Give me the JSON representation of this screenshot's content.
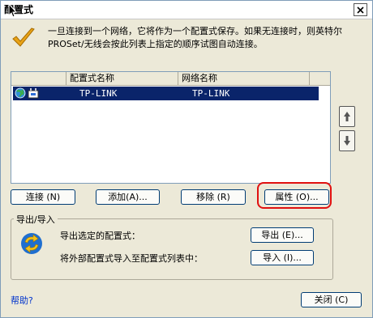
{
  "window": {
    "title": "配置式"
  },
  "intro_text": "一旦连接到一个网络，它将作为一个配置式保存。如果无连接时，则英特尔 PROSet/无线会按此列表上指定的顺序试图自动连接。",
  "list": {
    "columns": [
      "配置式名称",
      "网络名称"
    ],
    "rows": [
      {
        "profile_name": "TP-LINK",
        "network_name": "TP-LINK",
        "selected": true
      }
    ]
  },
  "buttons": {
    "connect": "连接 (N)",
    "add": "添加(A)...",
    "remove": "移除 (R)",
    "properties": "属性 (O)...",
    "export": "导出 (E)...",
    "import": "导入 (I)...",
    "close": "关闭 (C)"
  },
  "import_export": {
    "title": "导出/导入",
    "export_label": "导出选定的配置式：",
    "import_label": "将外部配置式导入至配置式列表中："
  },
  "help_link": "帮助?",
  "colors": {
    "selection": "#0a246a",
    "highlight_border": "#e01010",
    "dialog_bg": "#ece9d8"
  },
  "icons": [
    "close-icon",
    "checkmark-icon",
    "globe-icon",
    "network-card-icon",
    "arrow-up-icon",
    "arrow-down-icon",
    "sync-arrows-icon",
    "cursor-icon"
  ]
}
